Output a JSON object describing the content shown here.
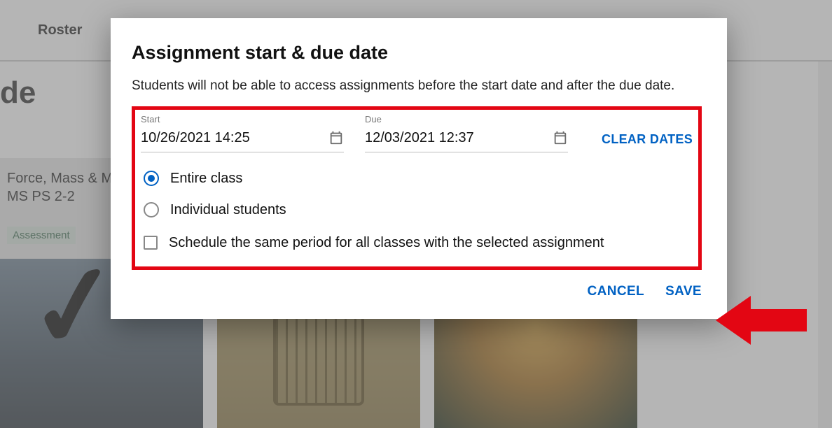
{
  "background": {
    "topbar": {
      "roster_tab": "Roster"
    },
    "title_fragment": "de",
    "card": {
      "line1": "Force, Mass & M",
      "line2": "MS PS 2-2",
      "badge": "Assessment"
    }
  },
  "modal": {
    "title": "Assignment start & due date",
    "description": "Students will not be able to access assignments before the start date and after the due date.",
    "start_label": "Start",
    "start_value": "10/26/2021 14:25",
    "due_label": "Due",
    "due_value": "12/03/2021 12:37",
    "clear_dates": "CLEAR DATES",
    "radio_entire": "Entire class",
    "radio_individual": "Individual students",
    "checkbox_same_period": "Schedule the same period for all classes with the selected assignment",
    "cancel": "CANCEL",
    "save": "SAVE"
  },
  "colors": {
    "accent": "#0061c3",
    "highlight": "#e30613"
  }
}
